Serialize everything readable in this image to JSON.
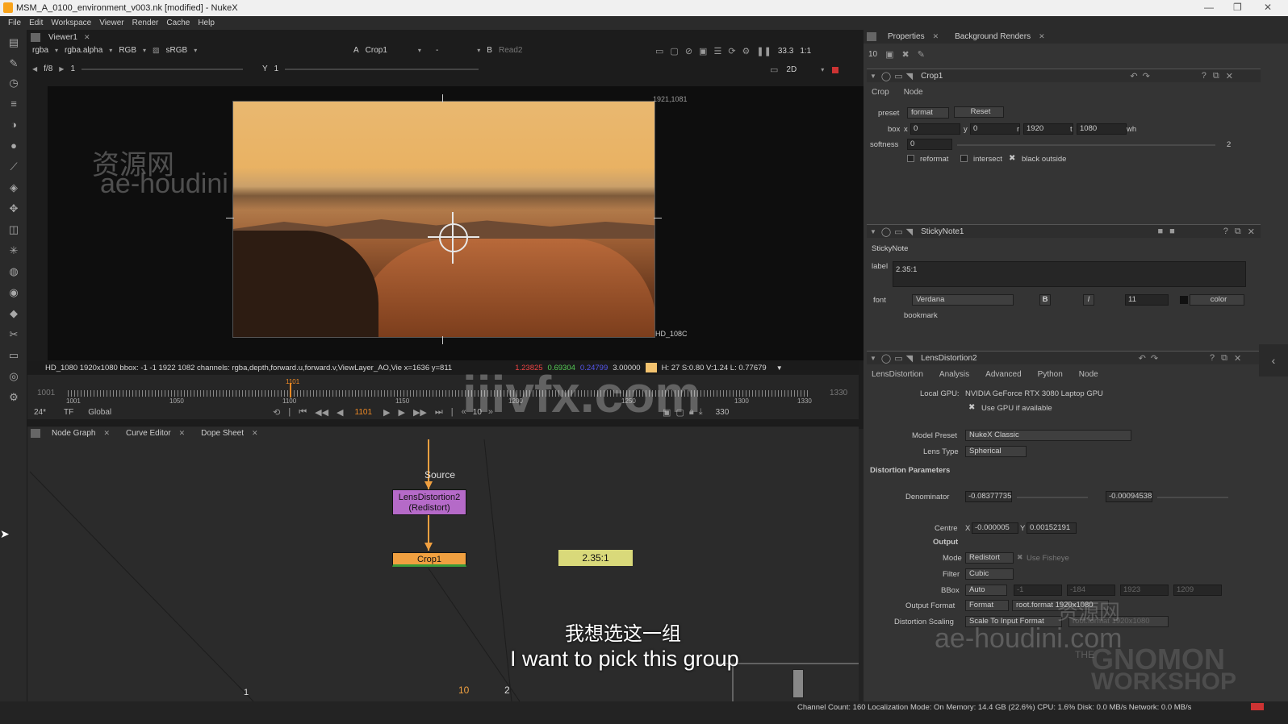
{
  "window": {
    "title": "MSM_A_0100_environment_v003.nk [modified] - NukeX"
  },
  "menu": [
    "File",
    "Edit",
    "Workspace",
    "Viewer",
    "Render",
    "Cache",
    "Help"
  ],
  "viewer": {
    "tab": "Viewer1",
    "channels": "rgba",
    "alpha": "rgba.alpha",
    "display": "RGB",
    "colorspace": "sRGB",
    "input_a_label": "A",
    "input_a": "Crop1",
    "input_dash": "-",
    "input_b_label": "B",
    "input_b": "Read2",
    "zoom": "33.3",
    "ratio": "1:1",
    "view_mode": "2D",
    "fstop": "f/8",
    "frame_y": "1",
    "gain_label": "Y",
    "gain": "1",
    "res_label": "1921,1081",
    "format_label": "HD_108C",
    "info": "HD_1080 1920x1080  bbox: -1 -1 1922 1082 channels: rgba,depth,forward.u,forward.v,ViewLayer_AO,Vie   x=1636 y=811",
    "pixel_r": "1.23825",
    "pixel_g": "0.69304",
    "pixel_b": "0.24799",
    "pixel_a": "3.00000",
    "pixel_hsl": "H: 27 S:0.80 V:1.24  L: 0.77679",
    "tl_start": "1001",
    "tl_end": "1330",
    "tl_labels": [
      "1001",
      "1050",
      "1100",
      "1150",
      "1200",
      "1250",
      "1300",
      "1330"
    ],
    "tl_current": "1101",
    "fps": "24*",
    "tf": "TF",
    "global": "Global",
    "frame": "1101",
    "step": "10",
    "end_frame": "330"
  },
  "bottom_tabs": [
    "Node Graph",
    "Curve Editor",
    "Dope Sheet"
  ],
  "nodes": {
    "source": "Source",
    "lens": "LensDistortion2",
    "lens_sub": "(Redistort)",
    "crop": "Crop1",
    "sticky": "2.35:1",
    "dot1": "1",
    "dot10": "10",
    "dot2": "2"
  },
  "subtitle": {
    "cn": "我想选这一组",
    "en": "I want to pick this group"
  },
  "watermarks": {
    "cn": "资源网",
    "en": "ae-houdini",
    "site": "iiivfx.com",
    "right": "ae-houdini.com",
    "right_cn": "资源网",
    "gnomon": "GNOMON",
    "workshop": "WORKSHOP",
    "the": "THE"
  },
  "properties": {
    "tabs": [
      "Properties",
      "Background Renders"
    ],
    "max_panels": "10",
    "crop": {
      "name": "Crop1",
      "tabs": [
        "Crop",
        "Node"
      ],
      "preset_label": "preset",
      "preset": "format",
      "reset": "Reset",
      "box_label": "box",
      "x_label": "x",
      "x": "0",
      "y_label": "y",
      "y": "0",
      "r_label": "r",
      "r": "1920",
      "t_label": "t",
      "t": "1080",
      "wh": "wh",
      "softness_label": "softness",
      "softness": "0",
      "softness_max": "2",
      "reformat": "reformat",
      "intersect": "intersect",
      "black_outside": "black outside"
    },
    "sticky": {
      "name": "StickyNote1",
      "tab": "StickyNote",
      "label_label": "label",
      "label": "2.35:1",
      "font_label": "font",
      "font": "Verdana",
      "bold": "B",
      "italic": "I",
      "size": "11",
      "color": "color",
      "bookmark": "bookmark"
    },
    "lens": {
      "name": "LensDistortion2",
      "tabs": [
        "LensDistortion",
        "Analysis",
        "Advanced",
        "Python",
        "Node"
      ],
      "gpu_label": "Local GPU:",
      "gpu": "NVIDIA GeForce RTX 3080 Laptop GPU",
      "use_gpu": "Use GPU if available",
      "model_preset_label": "Model Preset",
      "model_preset": "NukeX Classic",
      "lens_type_label": "Lens Type",
      "lens_type": "Spherical",
      "section": "Distortion Parameters",
      "denominator_label": "Denominator",
      "den1": "-0.08377735",
      "den2": "-0.00094538",
      "centre_label": "Centre",
      "centre_x": "-0.000005",
      "centre_y": "0.00152191",
      "output_section": "Output",
      "mode_label": "Mode",
      "mode": "Redistort",
      "use_fisheye": "Use Fisheye",
      "filter_label": "Filter",
      "filter": "Cubic",
      "bbox_label": "BBox",
      "bbox": "Auto",
      "bbox_vals": [
        "-1",
        "-184",
        "1923",
        "1209"
      ],
      "output_format_label": "Output Format",
      "output_format": "Format",
      "output_format_val": "root.format 1920x1080",
      "scaling_label": "Distortion Scaling",
      "scaling": "Scale To Input Format",
      "scaling_val": "root.format 1920x1080"
    }
  },
  "status": "Channel Count: 160  Localization Mode: On  Memory: 14.4 GB (22.6%)  CPU: 1.6%  Disk: 0.0 MB/s  Network: 0.0 MB/s",
  "colors": {
    "accent": "#f8a31b",
    "node_lens": "#b56ac8",
    "node_crop": "#f0a040",
    "sticky": "#d9d97a"
  }
}
